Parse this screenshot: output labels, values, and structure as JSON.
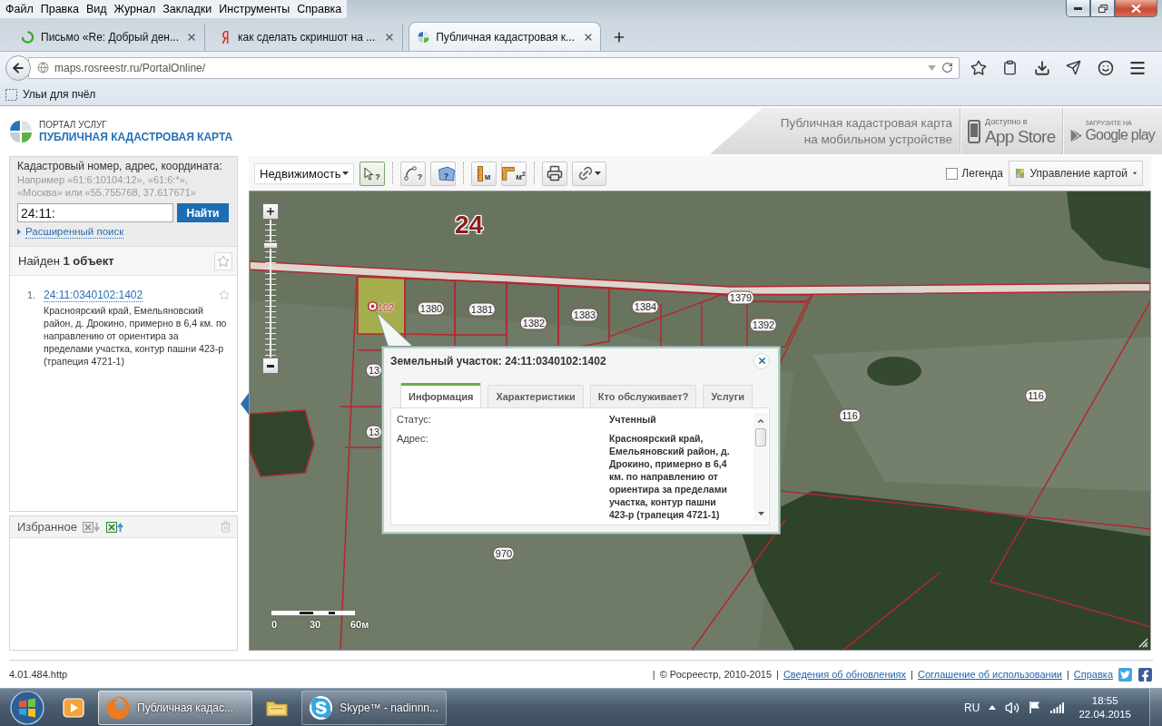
{
  "browser": {
    "menu": [
      "Файл",
      "Правка",
      "Вид",
      "Журнал",
      "Закладки",
      "Инструменты",
      "Справка"
    ],
    "tabs": [
      {
        "title": "Письмо «Re: Добрый ден...",
        "kind": "loading",
        "selected": false
      },
      {
        "title": "как сделать скриншот на ...",
        "kind": "yandex",
        "selected": false
      },
      {
        "title": "Публичная кадастровая к...",
        "kind": "site",
        "selected": true
      }
    ],
    "url": "maps.rosreestr.ru/PortalOnline/",
    "bookmarks": [
      "Ульи для пчёл"
    ]
  },
  "header": {
    "portal": "ПОРТАЛ УСЛУГ",
    "title": "ПУБЛИЧНАЯ КАДАСТРОВАЯ КАРТА",
    "promo_lines": [
      "Публичная кадастровая карта",
      "на мобильном устройстве"
    ],
    "badges": [
      {
        "kind": "app-store",
        "caption": "Доступно в",
        "name": "App Store"
      },
      {
        "kind": "google-play",
        "caption": "ЗАГРУЗИТЕ НА",
        "name": "Google play"
      }
    ]
  },
  "search": {
    "label": "Кадастровый номер, адрес, координата:",
    "hint_lines": [
      "Например «61:6:10104:12», «61:6:*»,",
      "«Москва» или «55.755768, 37.617671»"
    ],
    "value": "24:11:",
    "button": "Найти",
    "advanced_link": "Расширенный поиск"
  },
  "results": {
    "heading": "Найден **1 объект**",
    "items": [
      {
        "number": "1.",
        "cadastral_number": "24:11:0340102:1402",
        "address_lines": [
          "Красноярский край, Емельяновский",
          "район, д. Дрокино, примерно в 6,4 км. по",
          "направлению от ориентира за",
          "пределами участка, контур пашни 423-р",
          "(трапеция 4721-1)"
        ],
        "favorite": false
      }
    ]
  },
  "favorites": {
    "heading": "Избранное"
  },
  "toolbar": {
    "layer": "Недвижимость",
    "tools": [
      {
        "kind": "select",
        "glyph": "?",
        "selected": true
      },
      {
        "kind": "route-query",
        "glyph": "?",
        "selected": false
      },
      {
        "kind": "area-query",
        "glyph": "?",
        "selected": false
      },
      {
        "kind": "measure-length",
        "glyph": "м",
        "selected": false
      },
      {
        "kind": "measure-area",
        "glyph": "м$^{2}$",
        "selected": false
      },
      {
        "kind": "print",
        "selected": false
      },
      {
        "kind": "link",
        "selected": false
      }
    ],
    "legend": {
      "label": "Легенда",
      "checked": false
    },
    "map_control": "Управление картой"
  },
  "map": {
    "district": "24",
    "parcels": [
      {
        "label": "102",
        "selected": true
      },
      {
        "label": "1380",
        "selected": false
      },
      {
        "label": "1381",
        "selected": false
      },
      {
        "label": "1382",
        "selected": false
      },
      {
        "label": "1383",
        "selected": false
      },
      {
        "label": "1384",
        "selected": false
      },
      {
        "label": "1379",
        "selected": false
      },
      {
        "label": "1392",
        "selected": false
      },
      {
        "label": "13",
        "selected": false
      },
      {
        "label": "13",
        "selected": false
      },
      {
        "label": "116",
        "selected": false
      },
      {
        "label": "116",
        "selected": false
      },
      {
        "label": "970",
        "selected": false
      }
    ],
    "zoom": {
      "level": 0.83
    },
    "scale": [
      "0",
      "30",
      "60м"
    ]
  },
  "popup": {
    "title": "Земельный участок: 24:11:0340102:1402",
    "tabs": [
      {
        "label": "Информация",
        "selected": true
      },
      {
        "label": "Характеристики",
        "selected": false
      },
      {
        "label": "Кто обслуживает?",
        "selected": false
      },
      {
        "label": "Услуги",
        "selected": false
      }
    ],
    "rows": [
      {
        "label": "Статус:",
        "value_lines": [
          "Учтенный"
        ]
      },
      {
        "label": "Адрес:",
        "value_lines": [
          "Красноярский край,",
          "Емельяновский район, д.",
          "Дрокино, примерно в 6,4",
          "км. по направлению от",
          "ориентира за пределами",
          "участка, контур пашни",
          "423-р (трапеция 4721-1)"
        ]
      }
    ]
  },
  "footer": {
    "version": "4.01.484.http",
    "items": [
      {
        "kind": "separator",
        "text": "|"
      },
      {
        "kind": "text",
        "text": "© Росреестр, 2010-2015"
      },
      {
        "kind": "separator",
        "text": "|"
      },
      {
        "kind": "link",
        "text": "Сведения об обновлениях"
      },
      {
        "kind": "separator",
        "text": "|"
      },
      {
        "kind": "link",
        "text": "Соглашение об использовании"
      },
      {
        "kind": "separator",
        "text": "|"
      },
      {
        "kind": "link",
        "text": "Справка"
      }
    ]
  },
  "taskbar": {
    "apps": [
      {
        "kind": "media-player",
        "selected": false
      },
      {
        "kind": "firefox",
        "label": "Публичная кадас...",
        "selected": true
      },
      {
        "kind": "explorer",
        "selected": false
      },
      {
        "kind": "skype",
        "label": "Skype™ - nadinnn...",
        "selected": false
      }
    ],
    "language": "RU",
    "time": "18:55",
    "date": "22.04.2015"
  }
}
